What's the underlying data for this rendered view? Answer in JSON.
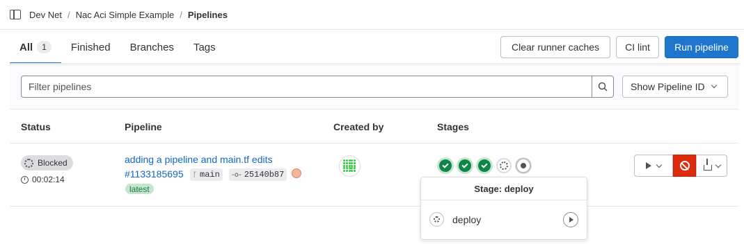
{
  "breadcrumb": {
    "items": [
      "Dev Net",
      "Nac Aci Simple Example",
      "Pipelines"
    ],
    "separator": "/"
  },
  "tabs": [
    {
      "label": "All",
      "count": "1",
      "active": true
    },
    {
      "label": "Finished"
    },
    {
      "label": "Branches"
    },
    {
      "label": "Tags"
    }
  ],
  "actions": {
    "clear_caches": "Clear runner caches",
    "ci_lint": "CI lint",
    "run_pipeline": "Run pipeline"
  },
  "filter": {
    "placeholder": "Filter pipelines",
    "id_dropdown": "Show Pipeline ID"
  },
  "table": {
    "headers": [
      "Status",
      "Pipeline",
      "Created by",
      "Stages"
    ]
  },
  "pipeline": {
    "status": "Blocked",
    "duration": "00:02:14",
    "title": "adding a pipeline and main.tf edits",
    "id": "#1133185695",
    "branch": "main",
    "commit": "25140b87",
    "tag": "latest"
  },
  "stages": [
    "success",
    "success",
    "success",
    "manual",
    "created"
  ],
  "popover": {
    "title": "Stage: deploy",
    "job": "deploy"
  },
  "colors": {
    "primary": "#1f75cb",
    "success": "#108548",
    "danger": "#dd2b0e",
    "link": "#1068bf"
  }
}
